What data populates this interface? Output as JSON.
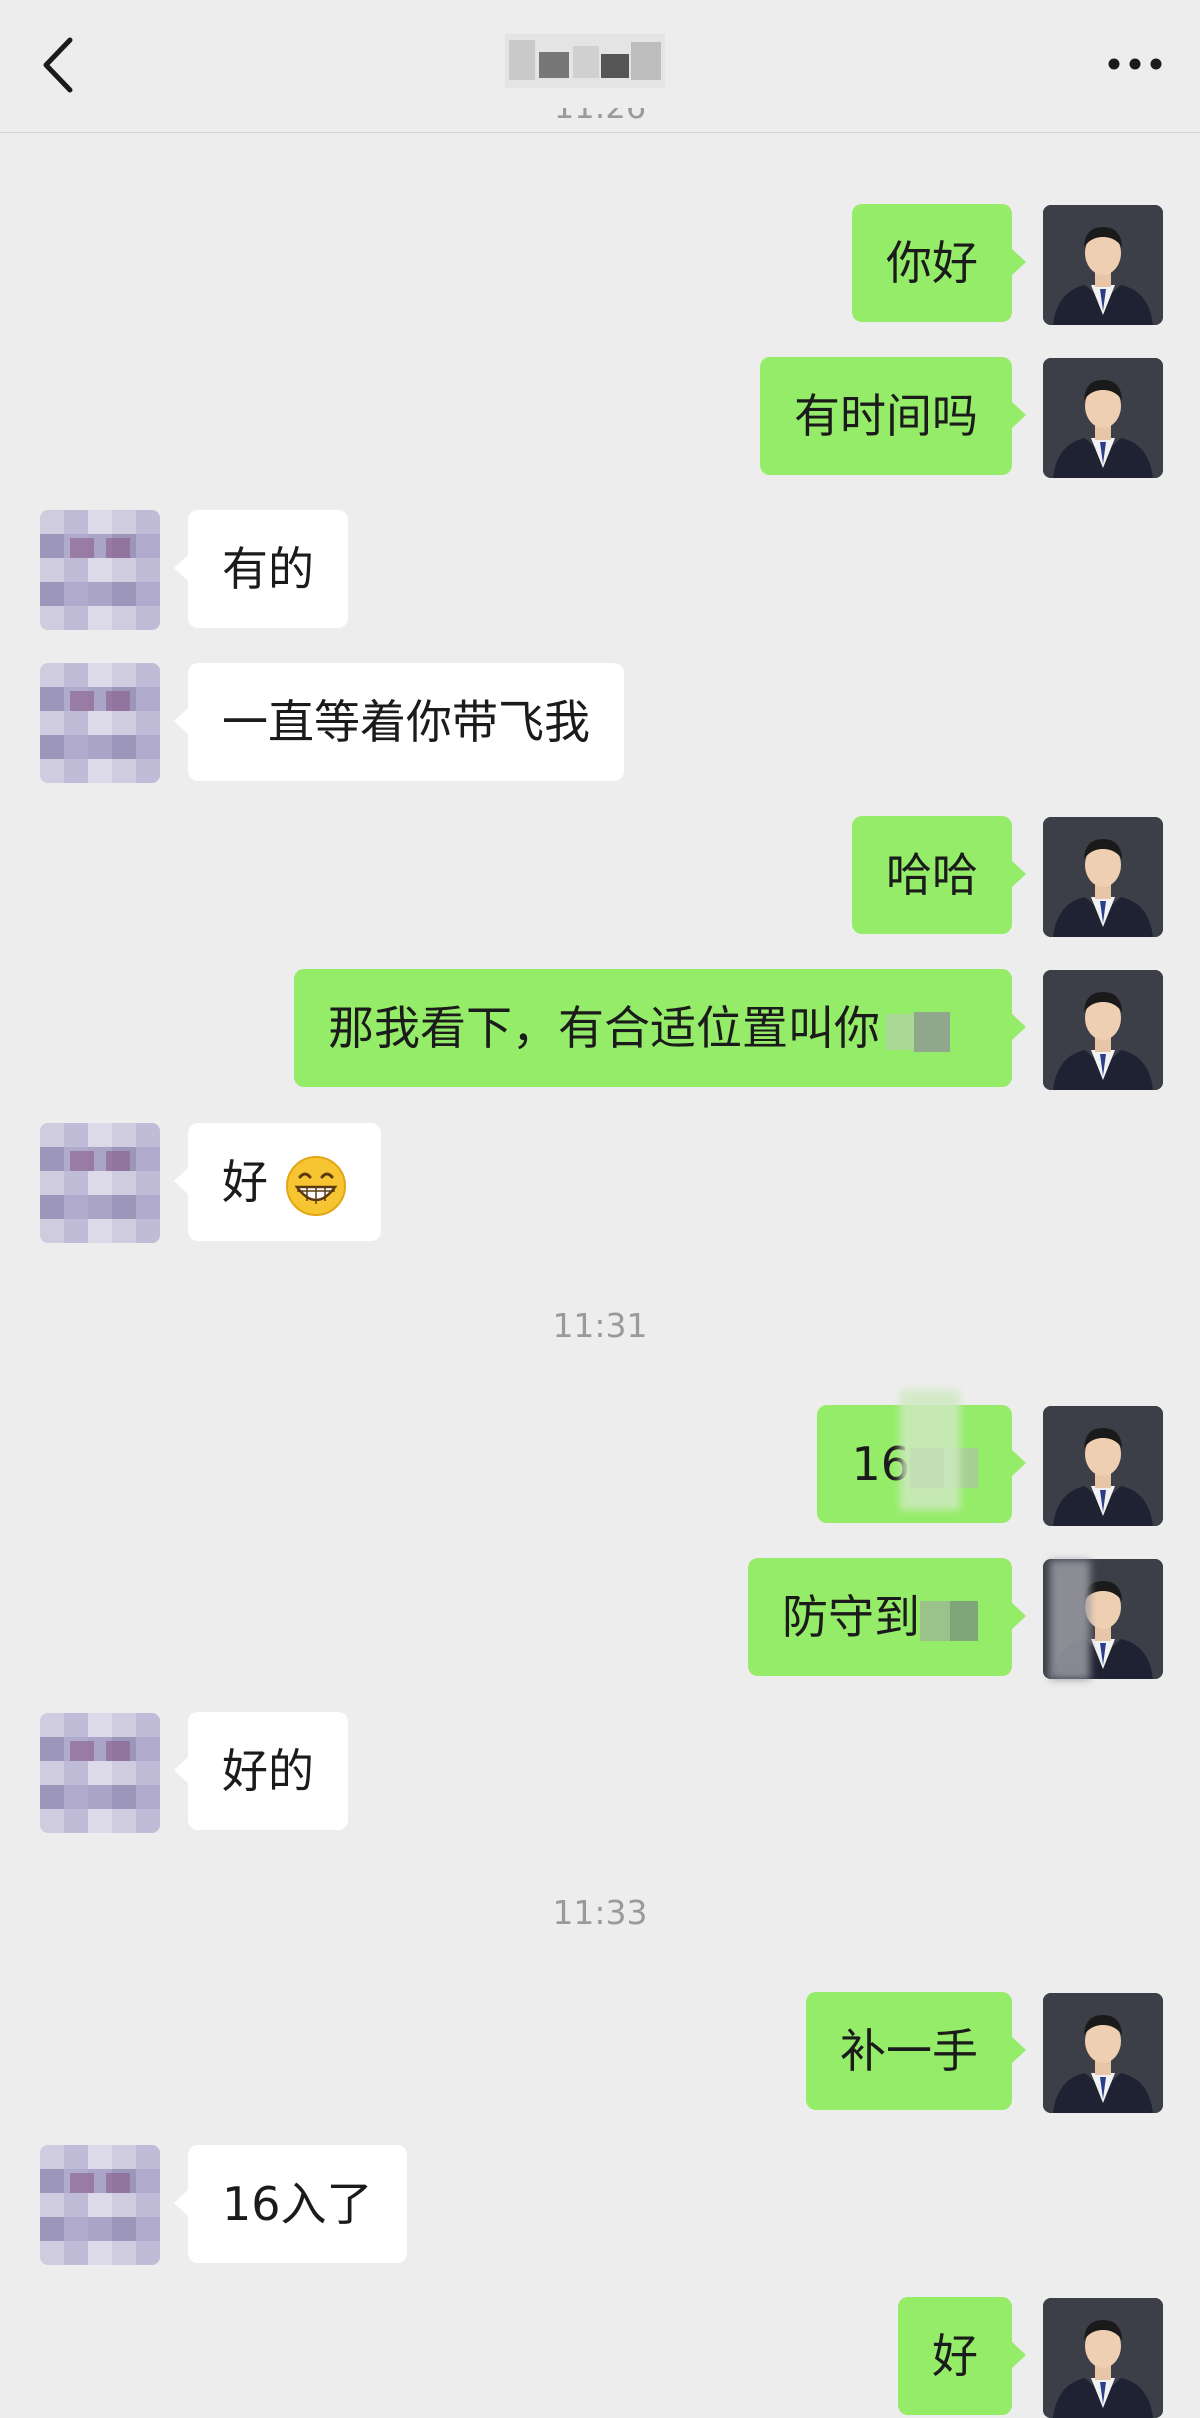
{
  "header": {
    "back_icon": "chevron-left-icon",
    "title": "",
    "more_icon": "ellipsis-icon"
  },
  "messages": [
    {
      "from": "me",
      "text": "你好"
    },
    {
      "from": "me",
      "text": "有时间吗"
    },
    {
      "from": "them",
      "text": "有的"
    },
    {
      "from": "them",
      "text": "一直等着你带飞我"
    },
    {
      "from": "me",
      "text": "哈哈"
    },
    {
      "from": "me",
      "text": "那我看下，有合适位置叫你"
    },
    {
      "from": "them",
      "text": "好",
      "emoji": "grinning-face-icon"
    },
    {
      "time": "11:31"
    },
    {
      "from": "me",
      "text": "16"
    },
    {
      "from": "me",
      "text": "防守到"
    },
    {
      "from": "them",
      "text": "好的"
    },
    {
      "time": "11:33"
    },
    {
      "from": "me",
      "text": "补一手"
    },
    {
      "from": "them",
      "text": "16入了"
    },
    {
      "from": "me",
      "text": "好"
    }
  ],
  "colors": {
    "background": "#ededed",
    "sent_bubble": "#95ec69",
    "received_bubble": "#ffffff",
    "timestamp_text": "#9a9a9a"
  }
}
